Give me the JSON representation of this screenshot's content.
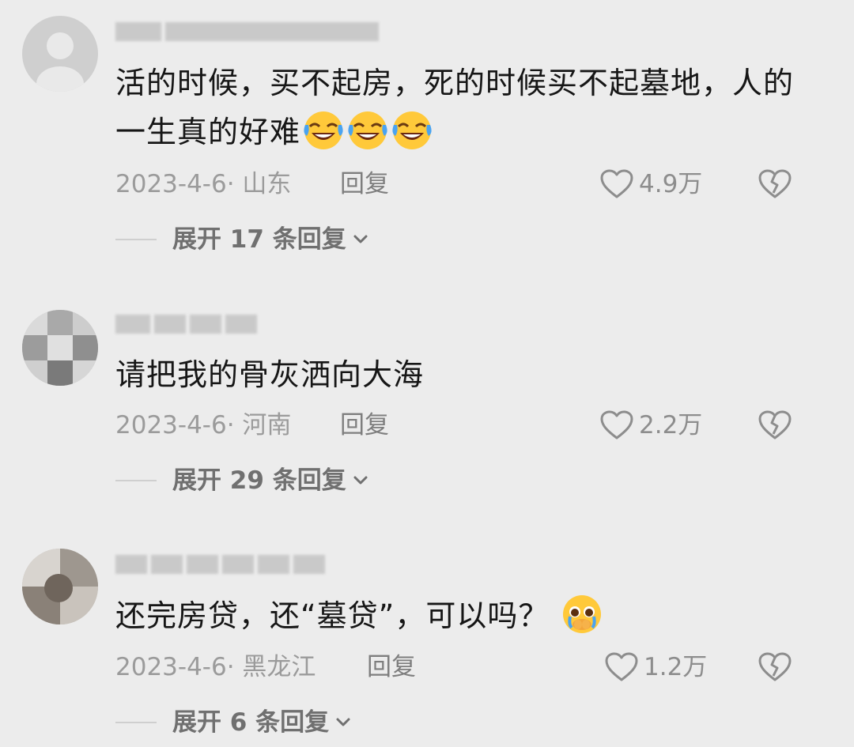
{
  "comments": [
    {
      "text_line1": "活的时候，买不起房，死的时候买不起墓地，人的",
      "text_line2": "一生真的好难",
      "emoji": "laughing-crying-emoji",
      "date": "2023-4-6",
      "location": "山东",
      "meta": "2023-4-6· 山东",
      "reply": "回复",
      "likes": "4.9万",
      "expand": "展开 17 条回复"
    },
    {
      "text": "请把我的骨灰洒向大海",
      "date": "2023-4-6",
      "location": "河南",
      "meta": "2023-4-6· 河南",
      "reply": "回复",
      "likes": "2.2万",
      "expand": "展开 29 条回复"
    },
    {
      "text": "还完房贷，还“墓贷”，可以吗？",
      "emoji": "pleading-crying-emoji",
      "date": "2023-4-6",
      "location": "黑龙江",
      "meta": "2023-4-6· 黑龙江",
      "reply": "回复",
      "likes": "1.2万",
      "expand": "展开 6 条回复"
    }
  ],
  "icons": {
    "like": "heart-outline-icon",
    "dislike": "broken-heart-icon",
    "expand": "chevron-down-icon"
  },
  "colors": {
    "background": "#ececec",
    "text": "#161616",
    "meta": "#9b9b9b",
    "expand": "#707070"
  }
}
